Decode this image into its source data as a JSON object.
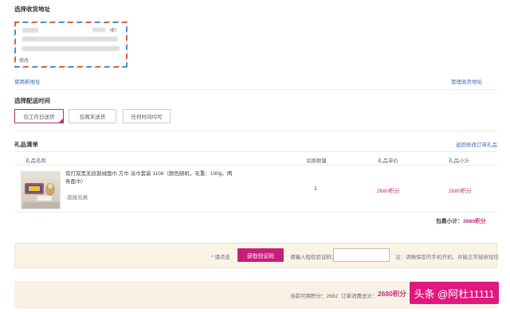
{
  "address": {
    "title": "选择收货地址",
    "receiver_suffix": "收）",
    "edit_label": "修改",
    "use_new_label": "使用新地址",
    "manage_label": "管理收货地址"
  },
  "delivery": {
    "title": "选择配送时间",
    "options": [
      "仅工作日送货",
      "仅周末送货",
      "任何时间均可"
    ],
    "selected_index": 0
  },
  "gift_list": {
    "title": "礼品清单",
    "return_link": "返回修改订单礼品",
    "columns": [
      "礼品名称",
      "兑换数量",
      "礼品单价",
      "礼品小计"
    ],
    "items": [
      {
        "name": "双灯双黑无捻割绒面巾 方巾 浴巾套装 1108（颜色随机，毛重：190g，两条面巾）",
        "note": "-直接兑换",
        "qty": "1",
        "unit_price": "2680积分",
        "subtotal": "2680积分"
      }
    ],
    "package_subtotal_label": "包裹小计：",
    "package_subtotal_value": "2680积分"
  },
  "verify": {
    "prompt": "* 请点击",
    "get_code_button": "获取验证码",
    "input_label": "请输入短信验证码：",
    "input_value": "",
    "note": "注：请确保您的手机开机，并能正常接收短信"
  },
  "summary": {
    "available_label": "当前可用积分：",
    "available_value": "2682",
    "total_label": "订单消费总计：",
    "total_value": "2680积分"
  },
  "watermark": {
    "text": "头条 @阿杜11111"
  },
  "colors": {
    "accent": "#c61f7a",
    "link": "#3a6cb4",
    "bar_bg": "#fbf3e6"
  }
}
